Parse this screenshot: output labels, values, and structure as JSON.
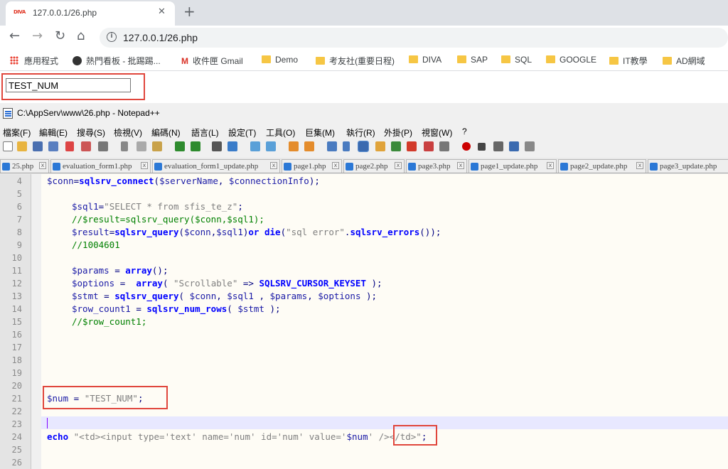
{
  "browser": {
    "tab": {
      "favicon_text": "DIVA",
      "title": "127.0.0.1/26.php",
      "close": "✕"
    },
    "newtab": "+",
    "nav": {
      "back": "←",
      "forward": "→",
      "reload": "↻",
      "home": "⌂"
    },
    "info": "i",
    "url": "127.0.0.1/26.php",
    "bookmarks": [
      {
        "label": "應用程式",
        "icon": "apps-icon"
      },
      {
        "label": "熱門看板 - 批踢踢...",
        "icon": "ptt-icon"
      },
      {
        "label": "收件匣 Gmail",
        "icon": "gmail-icon"
      },
      {
        "label": "Demo",
        "icon": "folder-icon"
      },
      {
        "label": "考友社(重要日程)",
        "icon": "folder-icon"
      },
      {
        "label": "DIVA",
        "icon": "folder-icon"
      },
      {
        "label": "SAP",
        "icon": "folder-icon"
      },
      {
        "label": "SQL",
        "icon": "folder-icon"
      },
      {
        "label": "GOOGLE",
        "icon": "folder-icon"
      },
      {
        "label": "IT教學",
        "icon": "folder-icon"
      },
      {
        "label": "AD網域",
        "icon": "folder-icon"
      }
    ]
  },
  "page": {
    "input_value": "TEST_NUM"
  },
  "npp": {
    "title": "C:\\AppServ\\www\\26.php - Notepad++",
    "menu": [
      "檔案(F)",
      "編輯(E)",
      "搜尋(S)",
      "檢視(V)",
      "編碼(N)",
      "語言(L)",
      "設定(T)",
      "工具(O)",
      "巨集(M)",
      "執行(R)",
      "外掛(P)",
      "視窗(W)",
      "?"
    ],
    "tabs": [
      "25.php",
      "evaluation_form1.php",
      "evaluation_form1_update.php",
      "page1.php",
      "page2.php",
      "page3.php",
      "page1_update.php",
      "page2_update.php",
      "page3_update.php"
    ],
    "tab_close": "x",
    "line_numbers": [
      "4",
      "5",
      "6",
      "7",
      "8",
      "9",
      "10",
      "11",
      "12",
      "13",
      "14",
      "15",
      "16",
      "17",
      "18",
      "19",
      "20",
      "21",
      "22",
      "23",
      "24",
      "25",
      "26"
    ],
    "code": {
      "l4": {
        "a": "$conn",
        "b": "=",
        "c": "sqlsrv_connect",
        "d": "(",
        "e": "$serverName",
        "f": ", ",
        "g": "$connectionInfo",
        "h": ");"
      },
      "l6": {
        "a": "$sql1",
        "b": "=",
        "c": "\"SELECT * from sfis_te_z\"",
        "d": ";"
      },
      "l7": "//$result=sqlsrv_query($conn,$sql1);",
      "l8": {
        "a": "$result",
        "b": "=",
        "c": "sqlsrv_query",
        "d": "(",
        "e": "$conn",
        "f": ",",
        "g": "$sql1",
        "h": ")",
        "i": "or",
        "j": " ",
        "k": "die",
        "l": "(",
        "m": "\"sql error\"",
        "n": ".",
        "o": "sqlsrv_errors",
        "p": "());"
      },
      "l9": "//1004601",
      "l11": {
        "a": "$params",
        "b": " = ",
        "c": "array",
        "d": "();"
      },
      "l12": {
        "a": "$options",
        "b": " =  ",
        "c": "array",
        "d": "( ",
        "e": "\"Scrollable\"",
        "f": " => ",
        "g": "SQLSRV_CURSOR_KEYSET",
        "h": " );"
      },
      "l13": {
        "a": "$stmt",
        "b": " = ",
        "c": "sqlsrv_query",
        "d": "( ",
        "e": "$conn",
        "f": ", ",
        "g": "$sql1",
        "h": " , ",
        "i": "$params",
        "j": ", ",
        "k": "$options",
        "l": " );"
      },
      "l14": {
        "a": "$row_count1",
        "b": " = ",
        "c": "sqlsrv_num_rows",
        "d": "( ",
        "e": "$stmt",
        "f": " );"
      },
      "l15": "//$row_count1;",
      "l21": {
        "a": "$num",
        "b": " = ",
        "c": "\"TEST_NUM\"",
        "d": ";"
      },
      "l24": {
        "a": "echo",
        "b": " ",
        "c": "\"<td><input type='text' name='num' id='num' value='",
        "d": "$num",
        "e": "' /></td>\"",
        "f": ";"
      }
    }
  }
}
